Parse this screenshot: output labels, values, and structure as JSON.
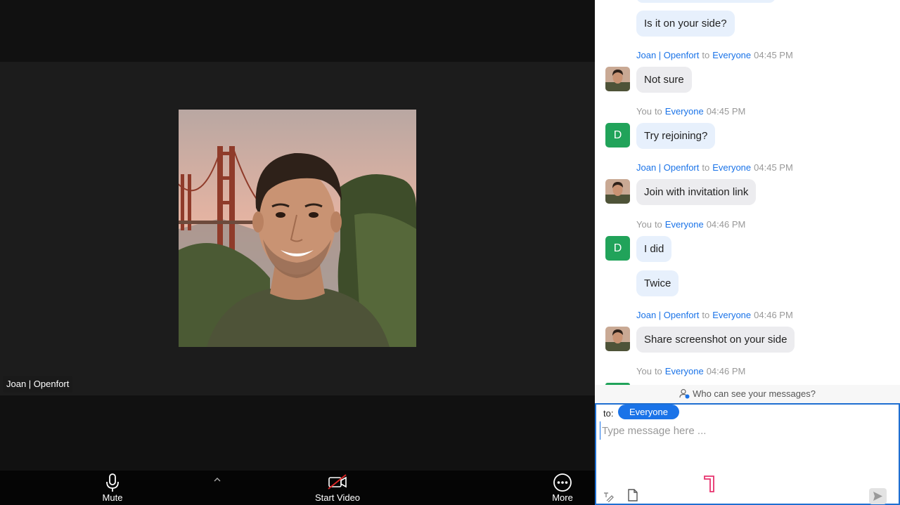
{
  "participant": {
    "name": "Joan | Openfort"
  },
  "toolbar": {
    "mute_label": "Mute",
    "video_label": "Start Video",
    "more_label": "More"
  },
  "chat": {
    "top_partial_message": "Is it on your side?",
    "groups": [
      {
        "sender": "Joan | Openfort",
        "to_word": "to",
        "recipient": "Everyone",
        "time": "04:45 PM",
        "messages": [
          "Not sure"
        ],
        "avatar": "photo"
      },
      {
        "sender": "You",
        "to_word": "to",
        "recipient": "Everyone",
        "time": "04:45 PM",
        "messages": [
          "Try rejoining?"
        ],
        "avatar_letter": "D"
      },
      {
        "sender": "Joan | Openfort",
        "to_word": "to",
        "recipient": "Everyone",
        "time": "04:45 PM",
        "messages": [
          "Join with invitation link"
        ],
        "avatar": "photo"
      },
      {
        "sender": "You",
        "to_word": "to",
        "recipient": "Everyone",
        "time": "04:46 PM",
        "messages": [
          "I did",
          "Twice"
        ],
        "avatar_letter": "D"
      },
      {
        "sender": "Joan | Openfort",
        "to_word": "to",
        "recipient": "Everyone",
        "time": "04:46 PM",
        "messages": [
          "Share screenshot on your side"
        ],
        "avatar": "photo"
      },
      {
        "sender": "You",
        "to_word": "to",
        "recipient": "Everyone",
        "time": "04:46 PM",
        "messages": []
      }
    ],
    "privacy_notice": "Who can see your messages?"
  },
  "compose": {
    "to_label": "to:",
    "recipient": "Everyone",
    "placeholder": "Type message here ..."
  },
  "colors": {
    "accent": "#1a73e8",
    "avatar_green": "#21a35a",
    "my_bubble": "#e7f0fc",
    "their_bubble": "#ececef",
    "video_off_red": "#e02828",
    "brand_pink": "#e8336e"
  }
}
